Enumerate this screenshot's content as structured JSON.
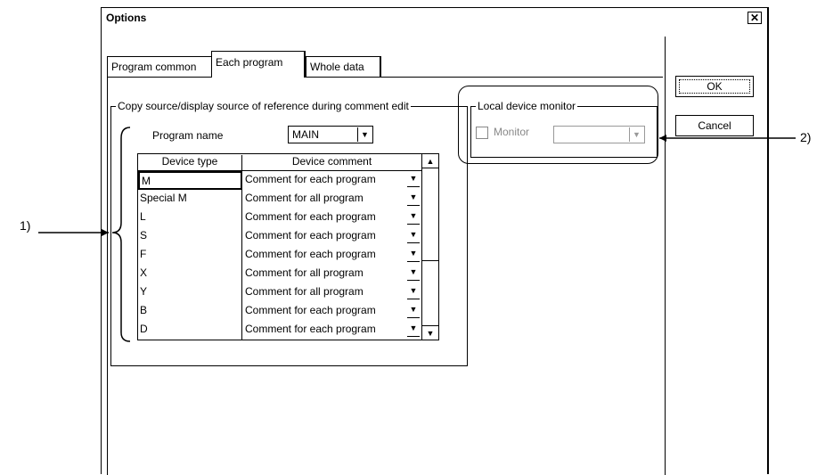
{
  "window": {
    "title": "Options",
    "close_glyph": "✕"
  },
  "tabs": [
    "Program common",
    "Each program",
    "Whole data"
  ],
  "buttons": {
    "ok": "OK",
    "cancel": "Cancel"
  },
  "copy_group": {
    "label": "Copy source/display source of reference during comment edit",
    "program_name_label": "Program name",
    "program_name_value": "MAIN",
    "table": {
      "headers": [
        "Device type",
        "Device comment"
      ],
      "rows": [
        {
          "type": "M",
          "comment": "Comment for each program"
        },
        {
          "type": "Special M",
          "comment": "Comment for all program"
        },
        {
          "type": "L",
          "comment": "Comment for each program"
        },
        {
          "type": "S",
          "comment": "Comment for each program"
        },
        {
          "type": "F",
          "comment": "Comment for each program"
        },
        {
          "type": "X",
          "comment": "Comment for all program"
        },
        {
          "type": "Y",
          "comment": "Comment for all program"
        },
        {
          "type": "B",
          "comment": "Comment for each program"
        },
        {
          "type": "D",
          "comment": "Comment for each program"
        }
      ]
    }
  },
  "local_group": {
    "label": "Local device monitor",
    "monitor_label": "Monitor",
    "monitor_checked": false
  },
  "callouts": {
    "one": "1)",
    "two": "2)"
  }
}
